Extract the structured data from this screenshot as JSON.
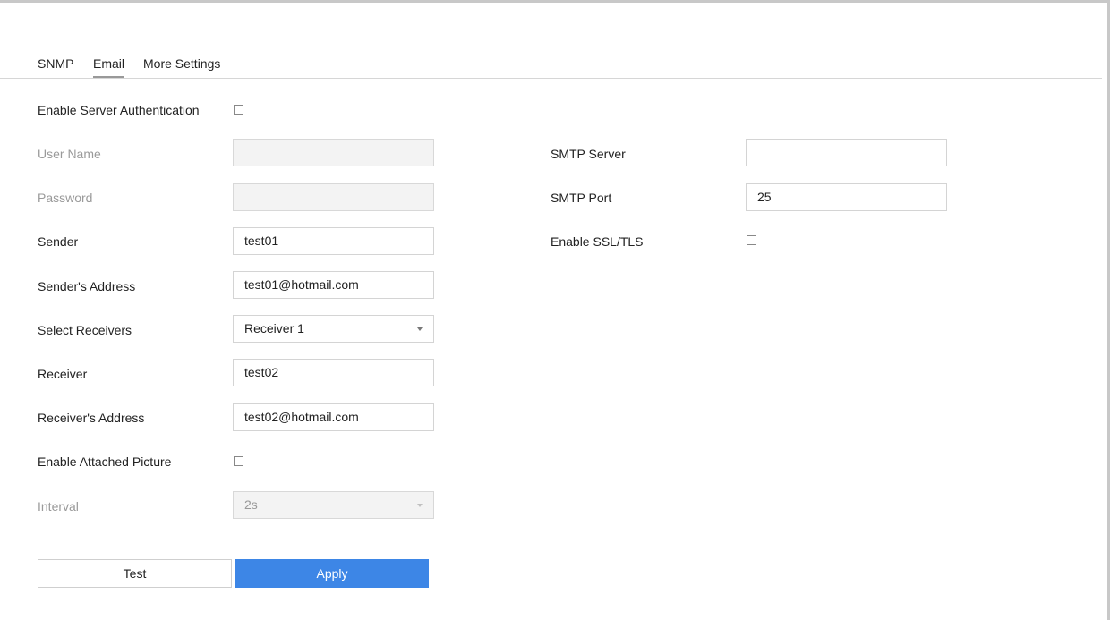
{
  "tabs": [
    {
      "label": "SNMP",
      "active": false
    },
    {
      "label": "Email",
      "active": true
    },
    {
      "label": "More Settings",
      "active": false
    }
  ],
  "form": {
    "enable_server_auth": {
      "label": "Enable Server Authentication",
      "checked": false
    },
    "user_name": {
      "label": "User Name",
      "value": "",
      "disabled": true
    },
    "password": {
      "label": "Password",
      "value": "",
      "disabled": true
    },
    "sender": {
      "label": "Sender",
      "value": "test01"
    },
    "sender_address": {
      "label": "Sender's Address",
      "value": "test01@hotmail.com"
    },
    "select_receivers": {
      "label": "Select Receivers",
      "value": "Receiver 1"
    },
    "receiver": {
      "label": "Receiver",
      "value": "test02"
    },
    "receiver_address": {
      "label": "Receiver's Address",
      "value": "test02@hotmail.com"
    },
    "enable_attached_picture": {
      "label": "Enable Attached Picture",
      "checked": false
    },
    "interval": {
      "label": "Interval",
      "value": "2s",
      "disabled": true
    },
    "smtp_server": {
      "label": "SMTP Server",
      "value": ""
    },
    "smtp_port": {
      "label": "SMTP Port",
      "value": "25"
    },
    "enable_ssl_tls": {
      "label": "Enable SSL/TLS",
      "checked": false
    }
  },
  "buttons": {
    "test_label": "Test",
    "apply_label": "Apply"
  },
  "colors": {
    "accent": "#3d86e6",
    "disabled_text": "#9a9a9a",
    "disabled_field": "#f3f3f3"
  }
}
